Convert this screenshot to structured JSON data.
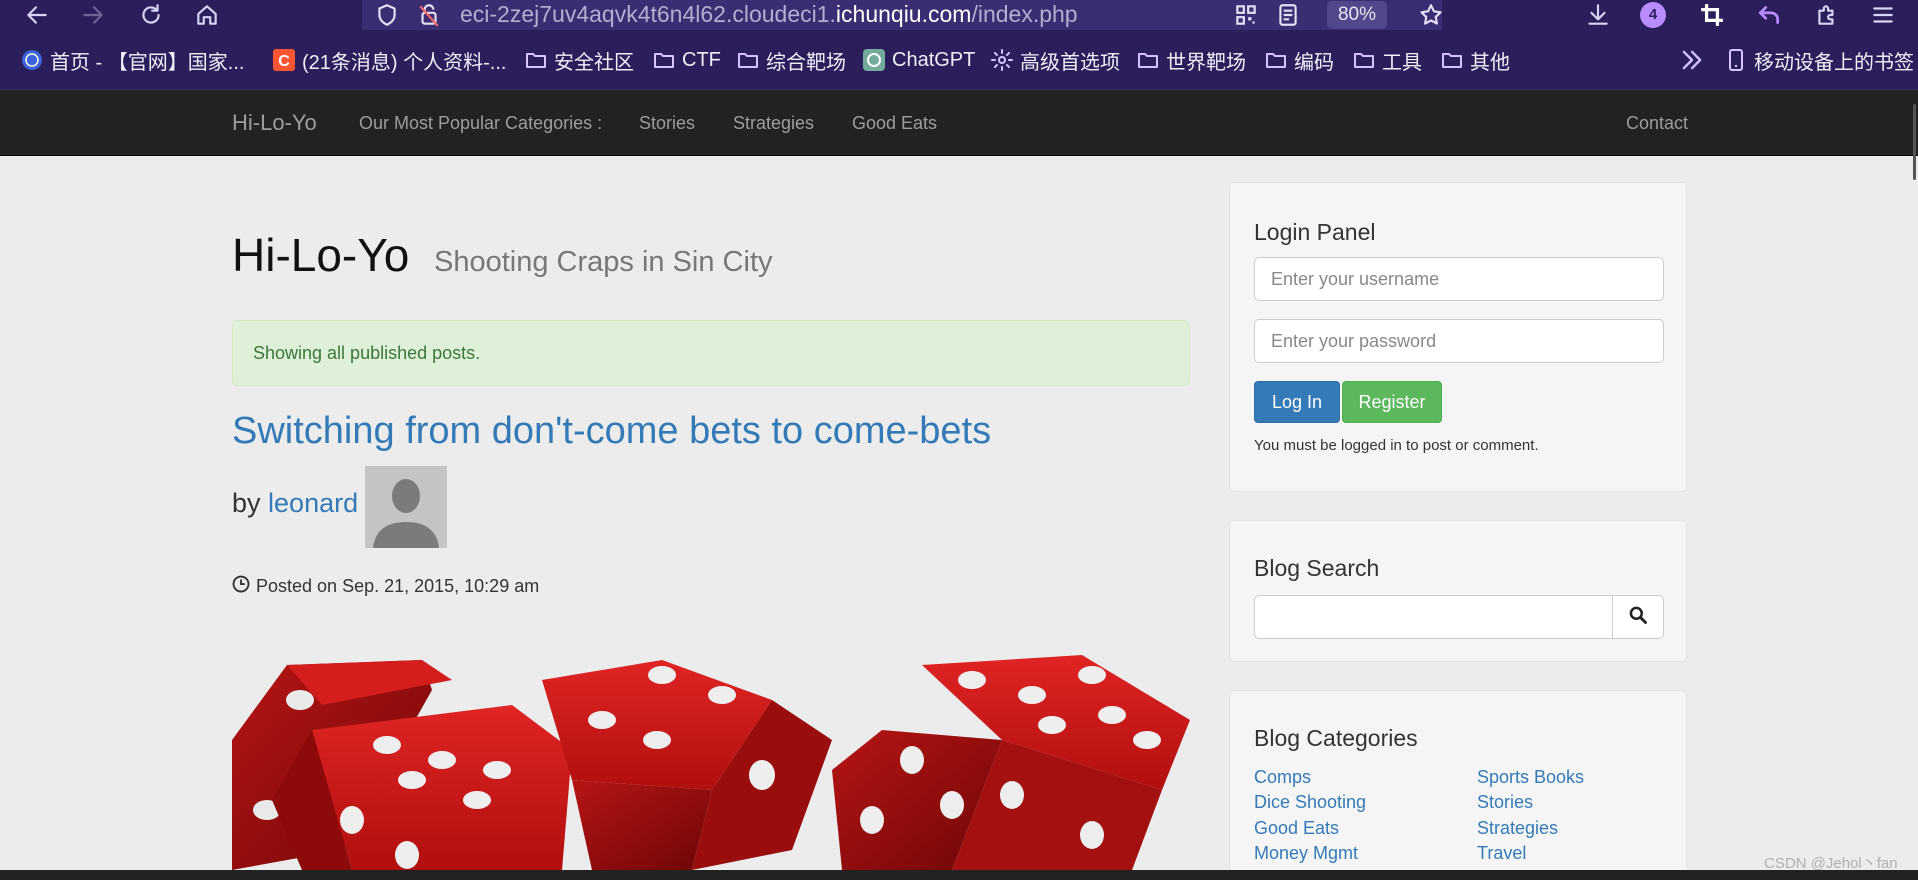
{
  "browser": {
    "url_prefix": "eci-2zej7uv4aqvk4t6n4l62.cloudeci1.",
    "url_host": "ichunqiu.com",
    "url_path": "/index.php",
    "zoom": "80%",
    "extensions_count": "4",
    "toolbar_icons": [
      "back-arrow-icon",
      "forward-arrow-icon",
      "reload-icon",
      "home-icon",
      "shield-icon",
      "insecure-lock-icon",
      "qr-code-icon",
      "reader-view-icon",
      "star-icon",
      "download-icon",
      "crop-icon",
      "undo-icon",
      "extensions-icon",
      "menu-icon"
    ]
  },
  "bookmarks": [
    {
      "label": "首页 - 【官网】国家...",
      "icon": "site-globe-icon"
    },
    {
      "label": "(21条消息) 个人资料-...",
      "icon": "csdn-icon"
    },
    {
      "label": "安全社区",
      "icon": "folder-icon"
    },
    {
      "label": "CTF",
      "icon": "folder-icon"
    },
    {
      "label": "综合靶场",
      "icon": "folder-icon"
    },
    {
      "label": "ChatGPT",
      "icon": "chatgpt-icon"
    },
    {
      "label": "高级首选项",
      "icon": "gear-icon"
    },
    {
      "label": "世界靶场",
      "icon": "folder-icon"
    },
    {
      "label": "编码",
      "icon": "folder-icon"
    },
    {
      "label": "工具",
      "icon": "folder-icon"
    },
    {
      "label": "其他",
      "icon": "folder-icon"
    },
    {
      "label": "移动设备上的书签",
      "icon": "mobile-icon"
    }
  ],
  "navbar": {
    "brand": "Hi-Lo-Yo",
    "categories_label": "Our Most Popular Categories :",
    "links": [
      "Stories",
      "Strategies",
      "Good Eats"
    ],
    "contact": "Contact"
  },
  "main": {
    "title": "Hi-Lo-Yo",
    "subtitle": "Shooting Craps in Sin City",
    "alert": "Showing all published posts.",
    "post": {
      "title": "Switching from don't-come bets to come-bets",
      "by": "by",
      "author": "leonard",
      "posted": "Posted on Sep. 21, 2015, 10:29 am"
    }
  },
  "sidebar": {
    "login": {
      "heading": "Login Panel",
      "username_placeholder": "Enter your username",
      "password_placeholder": "Enter your password",
      "login_button": "Log In",
      "register_button": "Register",
      "note": "You must be logged in to post or comment."
    },
    "search": {
      "heading": "Blog Search",
      "query": ""
    },
    "categories": {
      "heading": "Blog Categories",
      "left": [
        "Comps",
        "Dice Shooting",
        "Good Eats",
        "Money Mgmt"
      ],
      "right": [
        "Sports Books",
        "Stories",
        "Strategies",
        "Travel"
      ]
    }
  },
  "watermark": "CSDN @Jehol丶fan",
  "colors": {
    "browser_chrome": "#2b1e5a",
    "navbar": "#222222",
    "link": "#337ab7",
    "success": "#5cb85c",
    "primary": "#337ab7",
    "alert_bg": "#dff0d8"
  }
}
